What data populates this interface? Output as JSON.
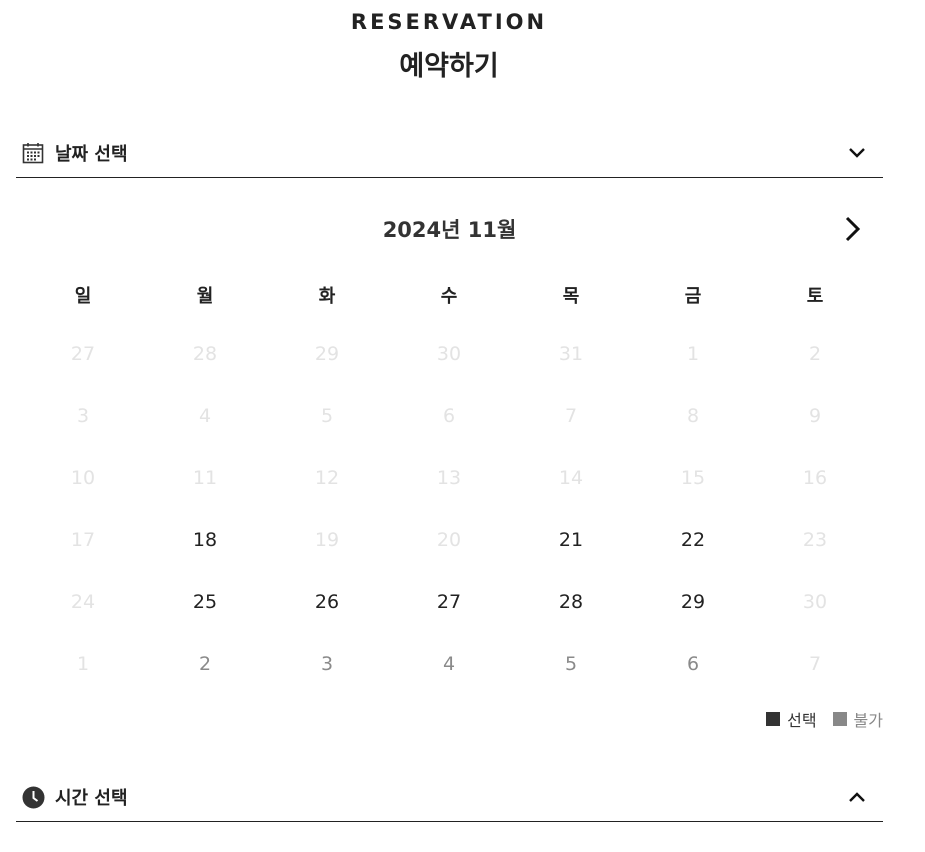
{
  "header": {
    "brand": "RESERVATION",
    "title": "예약하기"
  },
  "date_section": {
    "label": "날짜 선택",
    "icon": "calendar-icon",
    "toggle_icon": "chevron-down-icon"
  },
  "calendar": {
    "month_label": "2024년 11월",
    "next_icon": "chevron-right-icon",
    "weekdays": [
      "일",
      "월",
      "화",
      "수",
      "목",
      "금",
      "토"
    ],
    "weeks": [
      [
        {
          "d": "27",
          "s": "muted"
        },
        {
          "d": "28",
          "s": "muted"
        },
        {
          "d": "29",
          "s": "muted"
        },
        {
          "d": "30",
          "s": "muted"
        },
        {
          "d": "31",
          "s": "muted"
        },
        {
          "d": "1",
          "s": "muted"
        },
        {
          "d": "2",
          "s": "muted"
        }
      ],
      [
        {
          "d": "3",
          "s": "muted"
        },
        {
          "d": "4",
          "s": "muted"
        },
        {
          "d": "5",
          "s": "muted"
        },
        {
          "d": "6",
          "s": "muted"
        },
        {
          "d": "7",
          "s": "muted"
        },
        {
          "d": "8",
          "s": "muted"
        },
        {
          "d": "9",
          "s": "muted"
        }
      ],
      [
        {
          "d": "10",
          "s": "muted"
        },
        {
          "d": "11",
          "s": "muted"
        },
        {
          "d": "12",
          "s": "muted"
        },
        {
          "d": "13",
          "s": "muted"
        },
        {
          "d": "14",
          "s": "muted"
        },
        {
          "d": "15",
          "s": "muted"
        },
        {
          "d": "16",
          "s": "muted"
        }
      ],
      [
        {
          "d": "17",
          "s": "muted"
        },
        {
          "d": "18",
          "s": "avail"
        },
        {
          "d": "19",
          "s": "muted"
        },
        {
          "d": "20",
          "s": "muted"
        },
        {
          "d": "21",
          "s": "avail"
        },
        {
          "d": "22",
          "s": "avail"
        },
        {
          "d": "23",
          "s": "muted"
        }
      ],
      [
        {
          "d": "24",
          "s": "muted"
        },
        {
          "d": "25",
          "s": "avail"
        },
        {
          "d": "26",
          "s": "avail"
        },
        {
          "d": "27",
          "s": "avail"
        },
        {
          "d": "28",
          "s": "avail"
        },
        {
          "d": "29",
          "s": "avail"
        },
        {
          "d": "30",
          "s": "muted"
        }
      ],
      [
        {
          "d": "1",
          "s": "muted"
        },
        {
          "d": "2",
          "s": "next"
        },
        {
          "d": "3",
          "s": "next"
        },
        {
          "d": "4",
          "s": "next"
        },
        {
          "d": "5",
          "s": "next"
        },
        {
          "d": "6",
          "s": "next"
        },
        {
          "d": "7",
          "s": "muted"
        }
      ]
    ]
  },
  "legend": {
    "selected": {
      "label": "선택",
      "color": "#333333"
    },
    "unavailable": {
      "label": "불가",
      "color": "#888888"
    }
  },
  "time_section": {
    "label": "시간 선택",
    "icon": "clock-icon",
    "toggle_icon": "chevron-up-icon"
  }
}
